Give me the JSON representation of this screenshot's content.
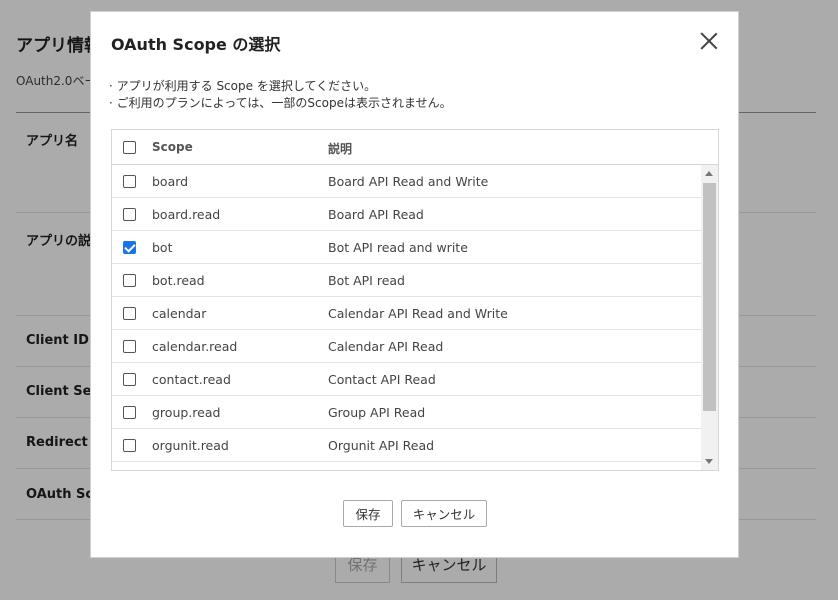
{
  "background": {
    "title": "アプリ情報",
    "subtitle": "OAuth2.0ベー",
    "rows": [
      "アプリ名",
      "アプリの説明",
      "Client ID",
      "Client Sec",
      "Redirect U",
      "OAuth Sco"
    ],
    "save_label": "保存",
    "cancel_label": "キャンセル"
  },
  "modal": {
    "title": "OAuth Scope の選択",
    "notes": [
      "· アプリが利用する Scope を選択してください。",
      "· ご利用のプランによっては、一部のScopeは表示されません。"
    ],
    "columns": {
      "scope": "Scope",
      "description": "説明"
    },
    "scopes": [
      {
        "scope": "board",
        "description": "Board API Read and Write",
        "checked": false
      },
      {
        "scope": "board.read",
        "description": "Board API Read",
        "checked": false
      },
      {
        "scope": "bot",
        "description": "Bot API read and write",
        "checked": true
      },
      {
        "scope": "bot.read",
        "description": "Bot API read",
        "checked": false
      },
      {
        "scope": "calendar",
        "description": "Calendar API Read and Write",
        "checked": false
      },
      {
        "scope": "calendar.read",
        "description": "Calendar API Read",
        "checked": false
      },
      {
        "scope": "contact.read",
        "description": "Contact API Read",
        "checked": false
      },
      {
        "scope": "group.read",
        "description": "Group API Read",
        "checked": false
      },
      {
        "scope": "orgunit.read",
        "description": "Orgunit API Read",
        "checked": false
      }
    ],
    "save_label": "保存",
    "cancel_label": "キャンセル",
    "accent_color": "#1a73e8"
  }
}
